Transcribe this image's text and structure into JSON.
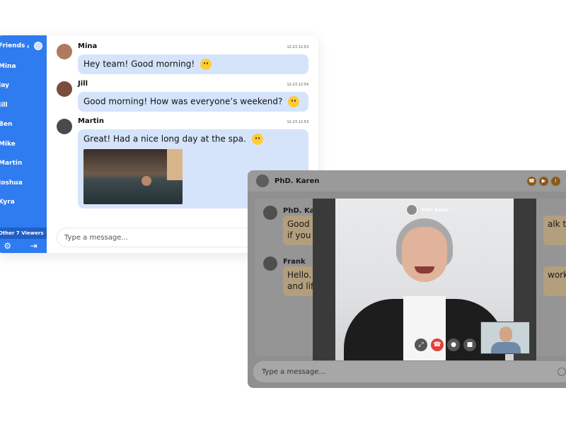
{
  "sidebar": {
    "title": "Friends",
    "items": [
      "Mina",
      "Jay",
      "Jill",
      "Ben",
      "Mike",
      "Martin",
      "Joshua",
      "Kyra"
    ],
    "viewers": "Other 7 Viewers"
  },
  "chat_a": {
    "messages": [
      {
        "name": "Mina",
        "time": "12-23 12:53",
        "text": "Hey team! Good morning!",
        "emoji": "smile-emoji",
        "avatar_color": "#b07a5e"
      },
      {
        "name": "Jill",
        "time": "12-23 12:54",
        "text": "Good morning! How was everyone’s weekend?",
        "emoji": "thinking-emoji",
        "avatar_color": "#7a4d3d"
      },
      {
        "name": "Martin",
        "time": "12-23 12:53",
        "text": "Great! Had a nice long day at the spa.",
        "emoji": "heart-eyes-emoji",
        "avatar_color": "#4a4a4a"
      }
    ],
    "input_placeholder": "Type a message..."
  },
  "chat_b": {
    "contact": "PhD. Karen",
    "messages": [
      {
        "name": "PhD. Karen",
        "left_text": [
          "Good",
          "if you"
        ],
        "right_text": "alk to m"
      },
      {
        "name": "Frank",
        "left_text": [
          "Hello.",
          "and lif"
        ],
        "right_text": "work"
      }
    ],
    "input_placeholder": "Type a message..."
  },
  "video_call": {
    "caller_name": "PhD. Karen"
  },
  "colors": {
    "sidebar_blue": "#2f7bf0",
    "bubble_blue": "#d5e4fb",
    "call_icon_brown": "#8a5a1c",
    "end_call_red": "#e0413c"
  }
}
